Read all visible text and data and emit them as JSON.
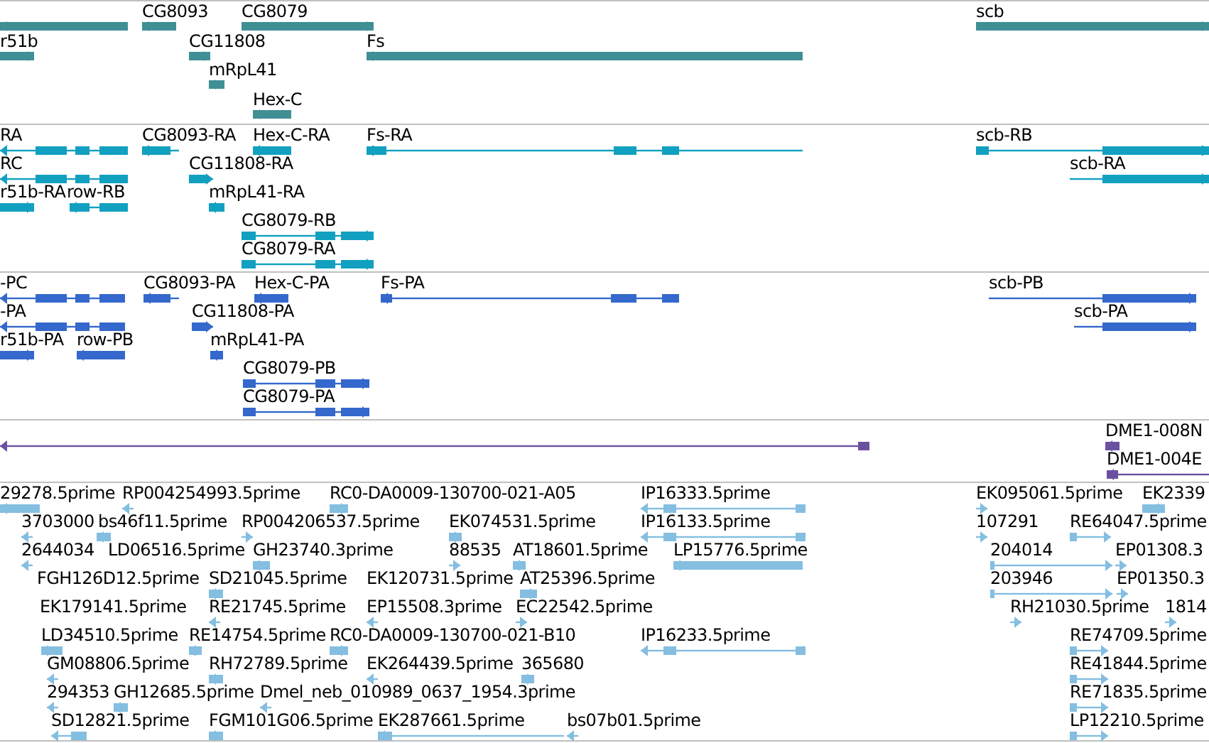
{
  "tracks": [
    {
      "kind": "gene",
      "features": [
        {
          "reverse": true
        },
        {
          "label": "CG8093",
          "reverse": true
        },
        {
          "label": "CG8079",
          "reverse": false
        },
        {
          "label": "scb",
          "reverse": false
        },
        {
          "label": "r51b",
          "reverse": false
        },
        {
          "label": "CG11808",
          "reverse": false
        },
        {
          "label": "Fs",
          "reverse": true
        },
        {
          "label": "mRpL41",
          "reverse": true
        },
        {
          "label": "Hex-C",
          "reverse": true
        }
      ]
    },
    {
      "kind": "transcript",
      "features": [
        {
          "label": "RA",
          "reverse": true
        },
        {
          "label": "CG8093-RA",
          "reverse": true
        },
        {
          "label": "Hex-C-RA",
          "reverse": true
        },
        {
          "label": "Fs-RA",
          "reverse": true
        },
        {
          "label": "scb-RB",
          "reverse": false
        },
        {
          "label": "RC",
          "reverse": true
        },
        {
          "label": "CG11808-RA",
          "reverse": false
        },
        {
          "label": "scb-RA",
          "reverse": false
        },
        {
          "label": "r51b-RA",
          "reverse": false
        },
        {
          "label": "row-RB",
          "reverse": true
        },
        {
          "label": "mRpL41-RA",
          "reverse": true
        },
        {
          "label": "CG8079-RB",
          "reverse": false
        },
        {
          "label": "CG8079-RA",
          "reverse": false
        }
      ]
    },
    {
      "kind": "protein",
      "features": [
        {
          "label": "-PC",
          "reverse": true
        },
        {
          "label": "CG8093-PA",
          "reverse": true
        },
        {
          "label": "Hex-C-PA",
          "reverse": true
        },
        {
          "label": "Fs-PA",
          "reverse": true
        },
        {
          "label": "scb-PB",
          "reverse": false
        },
        {
          "label": "-PA",
          "reverse": true
        },
        {
          "label": "CG11808-PA",
          "reverse": false
        },
        {
          "label": "scb-PA",
          "reverse": false
        },
        {
          "label": "r51b-PA",
          "reverse": false
        },
        {
          "label": "row-PB",
          "reverse": true
        },
        {
          "label": "mRpL41-PA",
          "reverse": true
        },
        {
          "label": "CG8079-PB",
          "reverse": false
        },
        {
          "label": "CG8079-PA",
          "reverse": false
        }
      ]
    },
    {
      "kind": "match",
      "features": [
        {
          "reverse": true
        },
        {
          "label": "DME1-008N",
          "reverse": true
        },
        {
          "label": "DME1-004E",
          "reverse": true
        }
      ]
    },
    {
      "kind": "est",
      "features": [
        {
          "label": "29278.5prime",
          "reverse": true
        },
        {
          "label": "RP004254993.5prime",
          "reverse": true
        },
        {
          "label": "RC0-DA0009-130700-021-A05",
          "reverse": false
        },
        {
          "label": "IP16333.5prime",
          "reverse": true
        },
        {
          "label": "EK095061.5prime",
          "reverse": false
        },
        {
          "label": "EK2339",
          "reverse": false
        },
        {
          "label": "3703000",
          "reverse": true
        },
        {
          "label": "bs46f11.5prime",
          "reverse": true
        },
        {
          "label": "RP004206537.5prime",
          "reverse": false
        },
        {
          "label": "EK074531.5prime",
          "reverse": false
        },
        {
          "label": "IP16133.5prime",
          "reverse": true
        },
        {
          "label": "107291",
          "reverse": false
        },
        {
          "label": "RE64047.5prime",
          "reverse": false
        },
        {
          "label": "2644034",
          "reverse": true
        },
        {
          "label": "LD06516.5prime"
        },
        {
          "label": "GH23740.3prime",
          "reverse": true
        },
        {
          "label": "88535",
          "reverse": false
        },
        {
          "label": "AT18601.5prime",
          "reverse": false
        },
        {
          "label": "LP15776.5prime",
          "reverse": true
        },
        {
          "label": "204014",
          "reverse": false
        },
        {
          "label": "EP01308.3",
          "reverse": false
        },
        {
          "label": "FGH126D12.5prime"
        },
        {
          "label": "SD21045.5prime",
          "reverse": true
        },
        {
          "label": "EK120731.5prime"
        },
        {
          "label": "AT25396.5prime",
          "reverse": false
        },
        {
          "label": "203946",
          "reverse": false
        },
        {
          "label": "EP01350.3",
          "reverse": false
        },
        {
          "label": "EK179141.5prime"
        },
        {
          "label": "RE21745.5prime",
          "reverse": true
        },
        {
          "label": "EP15508.3prime",
          "reverse": true
        },
        {
          "label": "EC22542.5prime",
          "reverse": false
        },
        {
          "label": "RH21030.5prime",
          "reverse": false
        },
        {
          "label": "1814",
          "reverse": false
        },
        {
          "label": "LD34510.5prime",
          "reverse": true
        },
        {
          "label": "RE14754.5prime",
          "reverse": false
        },
        {
          "label": "RC0-DA0009-130700-021-B10",
          "reverse": false
        },
        {
          "label": "IP16233.5prime",
          "reverse": true
        },
        {
          "label": "RE74709.5prime",
          "reverse": false
        },
        {
          "label": "GM08806.5prime",
          "reverse": true
        },
        {
          "label": "RH72789.5prime",
          "reverse": true
        },
        {
          "label": "EK264439.5prime",
          "reverse": true
        },
        {
          "label": "365680",
          "reverse": false
        },
        {
          "label": "RE41844.5prime",
          "reverse": false
        },
        {
          "label": "294353",
          "reverse": true
        },
        {
          "label": "GH12685.5prime",
          "reverse": true
        },
        {
          "label": "Dmel_neb_010989_0637_1954.3prime",
          "reverse": true
        },
        {
          "label": "RE71835.5prime",
          "reverse": false
        },
        {
          "label": "SD12821.5prime",
          "reverse": true
        },
        {
          "label": "FGM101G06.5prime",
          "reverse": true
        },
        {
          "label": "EK287661.5prime",
          "reverse": true
        },
        {
          "label": "bs07b01.5prime",
          "reverse": true
        },
        {
          "label": "LP12210.5prime",
          "reverse": false
        }
      ]
    }
  ]
}
